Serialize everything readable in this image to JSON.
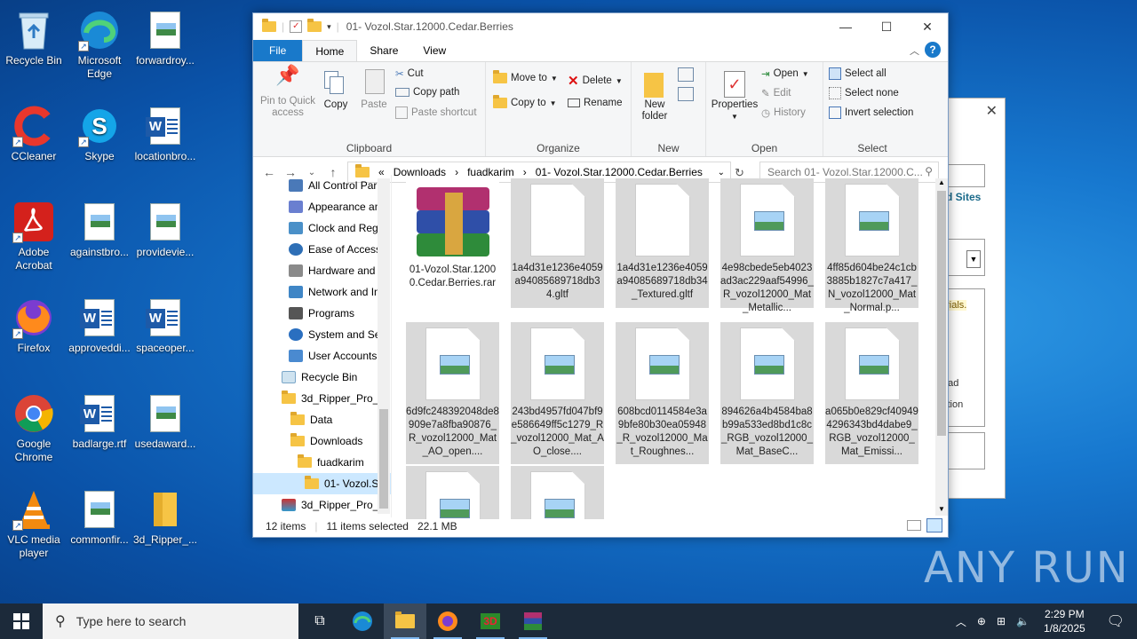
{
  "desktop": {
    "icons": [
      {
        "label": "Recycle Bin"
      },
      {
        "label": "Microsoft Edge"
      },
      {
        "label": "forwardroy..."
      },
      {
        "label": "CCleaner"
      },
      {
        "label": "Skype"
      },
      {
        "label": "locationbro..."
      },
      {
        "label": "Adobe Acrobat"
      },
      {
        "label": "againstbro..."
      },
      {
        "label": "providevie..."
      },
      {
        "label": "Firefox"
      },
      {
        "label": "approveddi..."
      },
      {
        "label": "spaceoper..."
      },
      {
        "label": "Google Chrome"
      },
      {
        "label": "badlarge.rtf"
      },
      {
        "label": "usedaward..."
      },
      {
        "label": "VLC media player"
      },
      {
        "label": "commonfir..."
      },
      {
        "label": "3d_Ripper_..."
      }
    ]
  },
  "bg_window": {
    "link_text": "d Sites",
    "hint_text": "erials.",
    "item1": "oad",
    "item2": "ction"
  },
  "explorer": {
    "title": "01- Vozol.Star.12000.Cedar.Berries",
    "tabs": [
      "File",
      "Home",
      "Share",
      "View"
    ],
    "ribbon": {
      "clipboard": {
        "pin": "Pin to Quick access",
        "copy": "Copy",
        "paste": "Paste",
        "cut": "Cut",
        "copy_path": "Copy path",
        "paste_shortcut": "Paste shortcut",
        "label": "Clipboard"
      },
      "organize": {
        "move_to": "Move to",
        "copy_to": "Copy to",
        "delete": "Delete",
        "rename": "Rename",
        "label": "Organize"
      },
      "new": {
        "new_folder": "New folder",
        "label": "New"
      },
      "open": {
        "properties": "Properties",
        "open": "Open",
        "edit": "Edit",
        "history": "History",
        "label": "Open"
      },
      "select": {
        "select_all": "Select all",
        "select_none": "Select none",
        "invert": "Invert selection",
        "label": "Select"
      }
    },
    "address": {
      "crumbs": [
        "Downloads",
        "fuadkarim",
        "01- Vozol.Star.12000.Cedar.Berries"
      ],
      "search_placeholder": "Search 01- Vozol.Star.12000.C..."
    },
    "nav": [
      {
        "label": "All Control Par"
      },
      {
        "label": "Appearance an"
      },
      {
        "label": "Clock and Regi"
      },
      {
        "label": "Ease of Access"
      },
      {
        "label": "Hardware and"
      },
      {
        "label": "Network and In"
      },
      {
        "label": "Programs"
      },
      {
        "label": "System and Se"
      },
      {
        "label": "User Accounts"
      },
      {
        "label": "Recycle Bin"
      },
      {
        "label": "3d_Ripper_Pro_v"
      },
      {
        "label": "Data"
      },
      {
        "label": "Downloads"
      },
      {
        "label": "fuadkarim"
      },
      {
        "label": "01- Vozol.St"
      },
      {
        "label": "3d_Ripper_Pro_v"
      }
    ],
    "files": [
      {
        "name": "01-Vozol.Star.12000.Cedar.Berries.rar"
      },
      {
        "name": "1a4d31e1236e4059a94085689718db34.gltf"
      },
      {
        "name": "1a4d31e1236e4059a94085689718db34_Textured.gltf"
      },
      {
        "name": "4e98cbede5eb4023ad3ac229aaf54996_R_vozol12000_Mat_Metallic..."
      },
      {
        "name": "4ff85d604be24c1cb3885b1827c7a417_N_vozol12000_Mat_Normal.p..."
      },
      {
        "name": "6d9fc248392048de8909e7a8fba90876_R_vozol12000_Mat_AO_open...."
      },
      {
        "name": "243bd4957fd047bf9e586649ff5c1279_R_vozol12000_Mat_AO_close...."
      },
      {
        "name": "608bcd0114584e3a9bfe80b30ea05948_R_vozol12000_Mat_Roughnes..."
      },
      {
        "name": "894626a4b4584ba8b99a533ed8bd1c8c_RGB_vozol12000_Mat_BaseC..."
      },
      {
        "name": "a065b0e829cf409494296343bd4dabe9_RGB_vozol12000_Mat_Emissi..."
      },
      {
        "name": ""
      },
      {
        "name": ""
      }
    ],
    "status": {
      "count": "12 items",
      "selected": "11 items selected",
      "size": "22.1 MB"
    }
  },
  "taskbar": {
    "search_placeholder": "Type here to search",
    "time": "2:29 PM",
    "date": "1/8/2025"
  },
  "watermark": "ANY RUN"
}
